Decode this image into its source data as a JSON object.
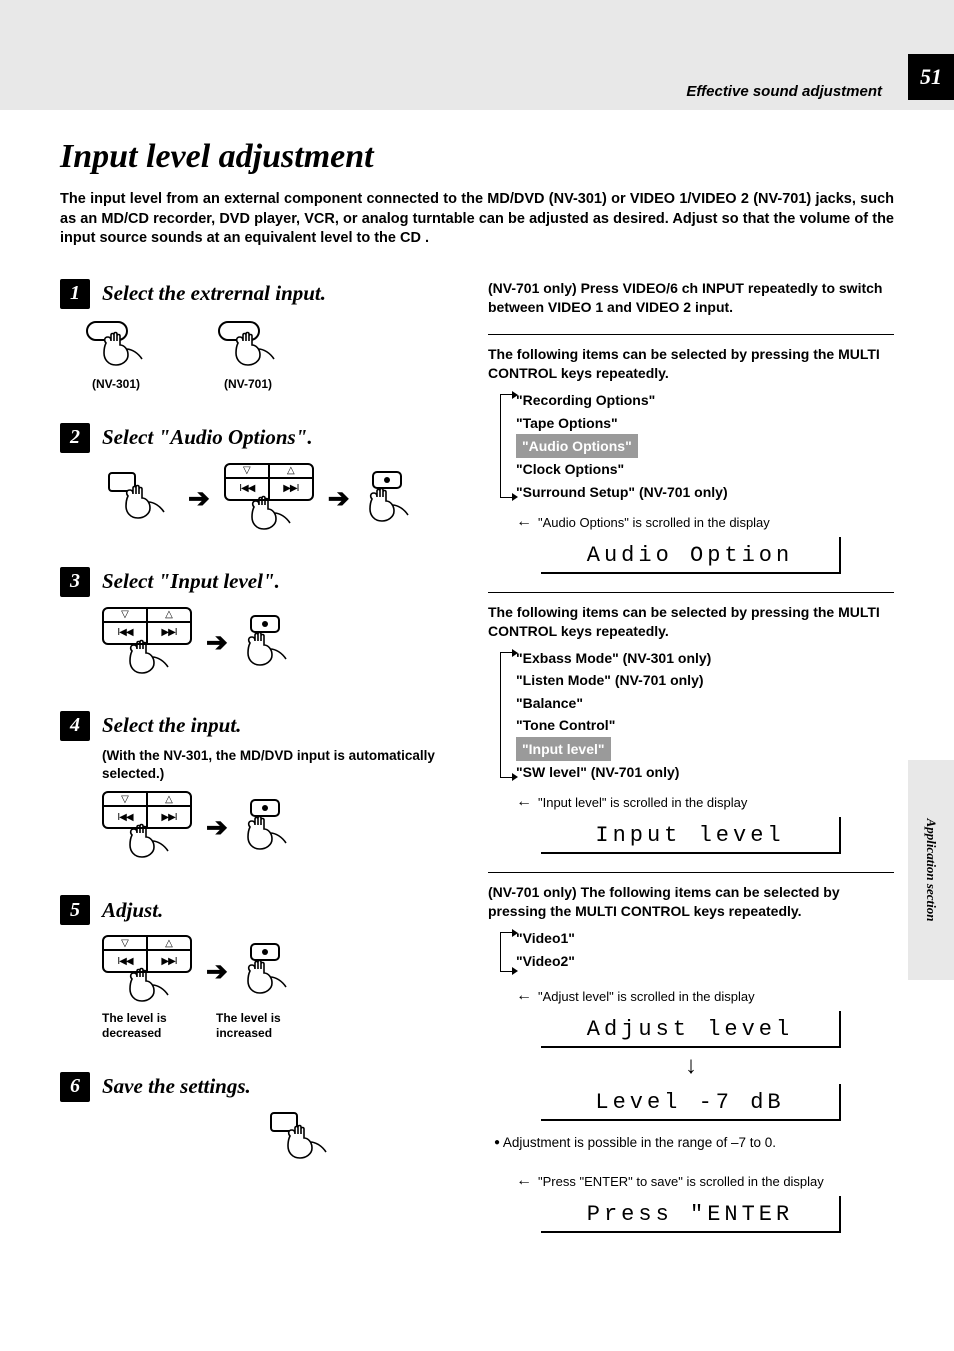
{
  "page_number": "51",
  "section_header": "Effective sound adjustment",
  "side_tab": "Application section",
  "title": "Input level adjustment",
  "intro": "The input level from an external component connected to the MD/DVD (NV-301) or VIDEO 1/VIDEO 2 (NV-701) jacks, such as an MD/CD recorder, DVD player, VCR, or analog turntable can be adjusted as desired. Adjust so that the volume of the input source sounds at an equivalent level to the CD .",
  "steps": [
    {
      "num": "1",
      "title": "Select the extrernal input.",
      "sub": "",
      "model_a": "(NV-301)",
      "model_b": "(NV-701)"
    },
    {
      "num": "2",
      "title": "Select \"Audio Options\".",
      "sub": ""
    },
    {
      "num": "3",
      "title": "Select \"Input level\".",
      "sub": ""
    },
    {
      "num": "4",
      "title": "Select the input.",
      "sub": "(With the NV-301, the MD/DVD input is automatically selected.)"
    },
    {
      "num": "5",
      "title": "Adjust.",
      "sub": "",
      "dec": "The level is decreased",
      "inc": "The level is increased"
    },
    {
      "num": "6",
      "title": "Save the settings.",
      "sub": ""
    }
  ],
  "right": {
    "nv701_note": "(NV-701 only) Press VIDEO/6 ch INPUT repeatedly to switch between VIDEO 1 and VIDEO 2 input.",
    "group1_intro": "The following items can be selected by pressing the MULTI CONTROL keys repeatedly.",
    "group1_items": [
      "\"Recording Options\"",
      "\"Tape Options\"",
      "\"Audio Options\"",
      "\"Clock Options\"",
      "\"Surround Setup\" (NV-701 only)"
    ],
    "group1_scroll": "\"Audio Options\" is scrolled in the display",
    "group1_lcd": "Audio Option",
    "group2_intro": "The following items can be selected by pressing the MULTI CONTROL keys repeatedly.",
    "group2_items": [
      "\"Exbass Mode\" (NV-301 only)",
      "\"Listen Mode\" (NV-701 only)",
      "\"Balance\"",
      "\"Tone Control\"",
      "\"Input level\"",
      "\"SW level\" (NV-701 only)"
    ],
    "group2_scroll": "\"Input level\" is scrolled in the display",
    "group2_lcd": "Input level",
    "group3_intro": "(NV-701 only) The following items can be selected by pressing the  MULTI CONTROL keys repeatedly.",
    "group3_items": [
      "\"Video1\"",
      "\"Video2\""
    ],
    "group3_scroll": "\"Adjust level\" is scrolled in the display",
    "group3_lcd1": "Adjust level",
    "group3_lcd2": "Level -7 dB",
    "range_note": "Adjustment is possible in the range of –7 to 0.",
    "enter_scroll": "\"Press \"ENTER\" to save\" is scrolled in the display",
    "enter_lcd": "Press \"ENTER"
  }
}
